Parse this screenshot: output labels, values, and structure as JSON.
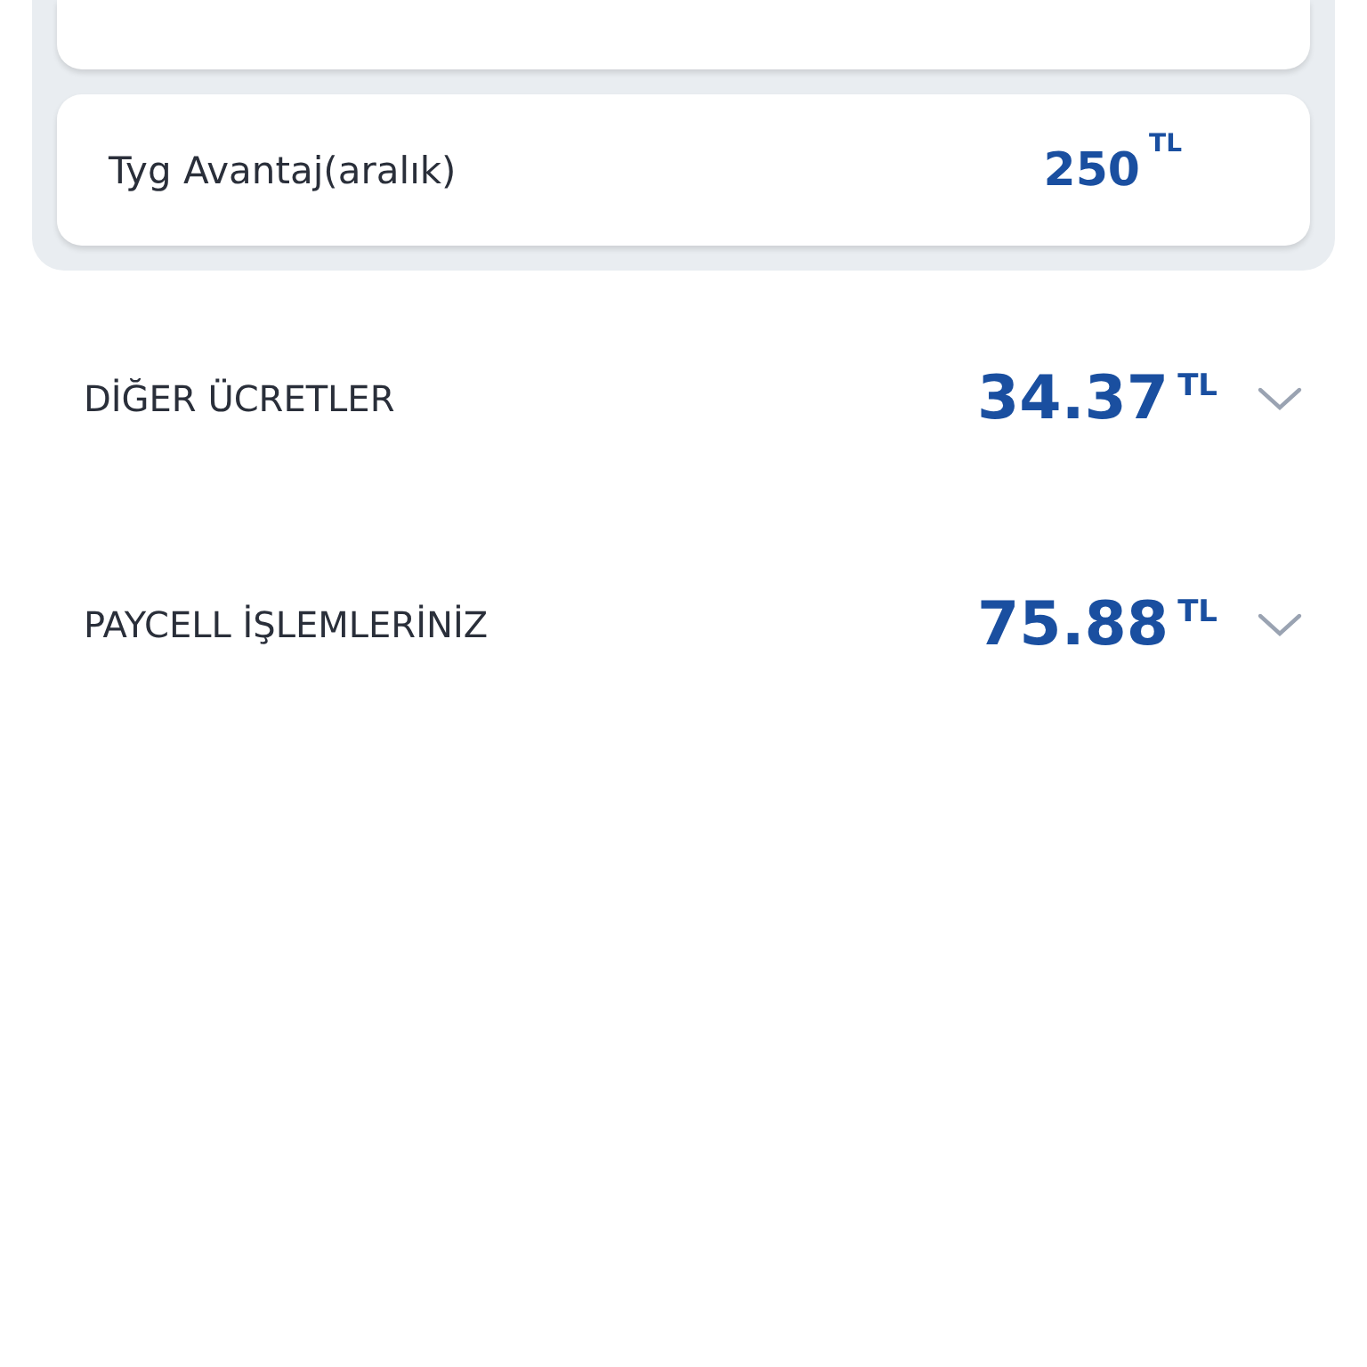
{
  "campaign_items": [
    {
      "label": "Tyg Avantaj(aralık)",
      "amount": "250",
      "currency": "TL"
    }
  ],
  "sections": [
    {
      "title": "DİĞER ÜCRETLER",
      "amount": "34.37",
      "currency": "TL",
      "expanded": false
    },
    {
      "title": "PAYCELL İŞLEMLERİNİZ",
      "amount": "75.88",
      "currency": "TL",
      "expanded": false
    }
  ]
}
